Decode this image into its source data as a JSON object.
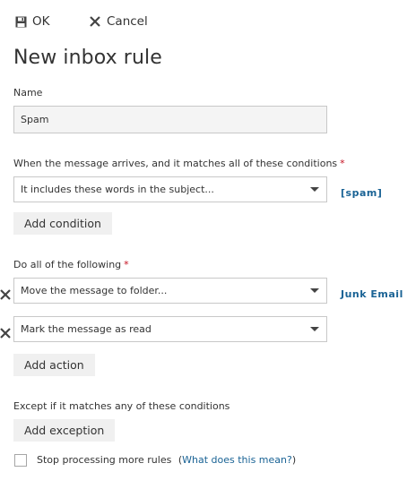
{
  "toolbar": {
    "ok_label": "OK",
    "cancel_label": "Cancel"
  },
  "page_title": "New inbox rule",
  "name_field": {
    "label": "Name",
    "value": "Spam"
  },
  "conditions": {
    "label": "When the message arrives, and it matches all of these conditions",
    "required_mark": "*",
    "selected": "It includes these words in the subject...",
    "value_link": "[spam]",
    "add_button": "Add condition"
  },
  "actions": {
    "label": "Do all of the following",
    "required_mark": "*",
    "items": [
      {
        "selected": "Move the message to folder...",
        "value_link": "Junk Email"
      },
      {
        "selected": "Mark the message as read",
        "value_link": ""
      }
    ],
    "add_button": "Add action"
  },
  "exceptions": {
    "label": "Except if it matches any of these conditions",
    "add_button": "Add exception"
  },
  "stop_processing": {
    "checked": false,
    "label": "Stop processing more rules",
    "help_open": "(",
    "help_link": "What does this mean?",
    "help_close": ")"
  },
  "colors": {
    "link": "#1a6395",
    "required": "#c50f1f",
    "button_bg": "#f0f0f0",
    "input_bg": "#f4f4f4"
  },
  "icons": {
    "ok": "save-icon",
    "cancel": "close-icon",
    "dropdown": "caret-down-icon",
    "delete": "delete-x-icon"
  }
}
